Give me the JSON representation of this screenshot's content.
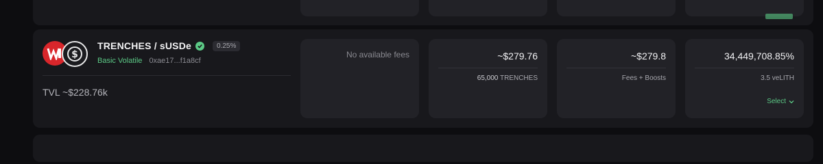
{
  "pool": {
    "pair": "TRENCHES / sUSDe",
    "fee": "0.25%",
    "type": "Basic Volatile",
    "address": "0xae17...f1a8cf",
    "tvl": "TVL ~$228.76k"
  },
  "fees": {
    "text": "No available fees"
  },
  "volume": {
    "value": "~$279.76",
    "amount": "65,000",
    "token": "TRENCHES"
  },
  "rewards": {
    "value": "~$279.8",
    "label": "Fees + Boosts"
  },
  "apr": {
    "value": "34,449,708.85%",
    "votes": "3.5 veLITH",
    "action": "Select"
  },
  "colors": {
    "accent": "#5cc986",
    "logo_red": "#d9262b"
  },
  "icons": [
    "trenches-logo-icon",
    "susde-logo-icon",
    "verified-icon",
    "chevron-down-icon"
  ]
}
